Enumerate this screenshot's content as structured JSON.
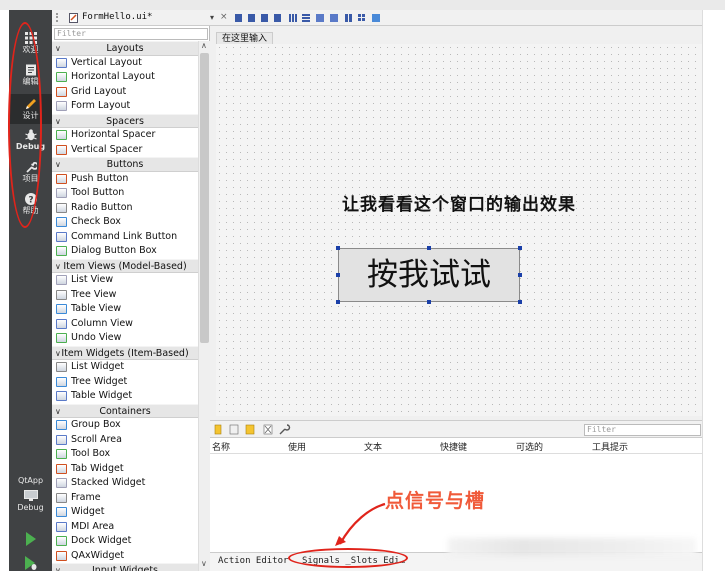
{
  "mode_bar": {
    "items": [
      {
        "label": "欢迎",
        "icon": "welcome-grid-icon"
      },
      {
        "label": "编辑",
        "icon": "edit-document-icon"
      },
      {
        "label": "设计",
        "icon": "design-pencil-icon"
      },
      {
        "label": "Debug",
        "icon": "debug-bug-icon"
      },
      {
        "label": "项目",
        "icon": "project-wrench-icon"
      },
      {
        "label": "帮助",
        "icon": "help-question-icon"
      }
    ],
    "kit_label": "QtApp",
    "kit_mode": "Debug"
  },
  "editor": {
    "file_name": "FormHello.ui*"
  },
  "widget_box": {
    "filter_placeholder": "Filter",
    "categories": [
      {
        "name": "Layouts",
        "items": [
          "Vertical Layout",
          "Horizontal Layout",
          "Grid Layout",
          "Form Layout"
        ]
      },
      {
        "name": "Spacers",
        "items": [
          "Horizontal Spacer",
          "Vertical Spacer"
        ]
      },
      {
        "name": "Buttons",
        "items": [
          "Push Button",
          "Tool Button",
          "Radio Button",
          "Check Box",
          "Command Link Button",
          "Dialog Button Box"
        ]
      },
      {
        "name": "Item Views (Model-Based)",
        "items": [
          "List View",
          "Tree View",
          "Table View",
          "Column View",
          "Undo View"
        ]
      },
      {
        "name": "Item Widgets (Item-Based)",
        "items": [
          "List Widget",
          "Tree Widget",
          "Table Widget"
        ]
      },
      {
        "name": "Containers",
        "items": [
          "Group Box",
          "Scroll Area",
          "Tool Box",
          "Tab Widget",
          "Stacked Widget",
          "Frame",
          "Widget",
          "MDI Area",
          "Dock Widget",
          "QAxWidget"
        ]
      },
      {
        "name": "Input Widgets",
        "items": []
      }
    ]
  },
  "form": {
    "menu_placeholder": "在这里输入",
    "label_text": "让我看看这个窗口的输出效果",
    "button_text": "按我试试"
  },
  "action_editor": {
    "filter_placeholder": "Filter",
    "columns": [
      "名称",
      "使用",
      "文本",
      "快捷键",
      "可选的",
      "工具提示"
    ]
  },
  "bottom_tabs": {
    "action_editor": "Action Editor",
    "signals_slots": "Signals _Slots Edi…"
  },
  "annotation": {
    "text": "点信号与槽"
  },
  "colors": {
    "annotation_red": "#e0241b",
    "annotation_text": "#f05a3a",
    "selection_handle": "#1a3fa8",
    "mode_bar": "#404244"
  }
}
